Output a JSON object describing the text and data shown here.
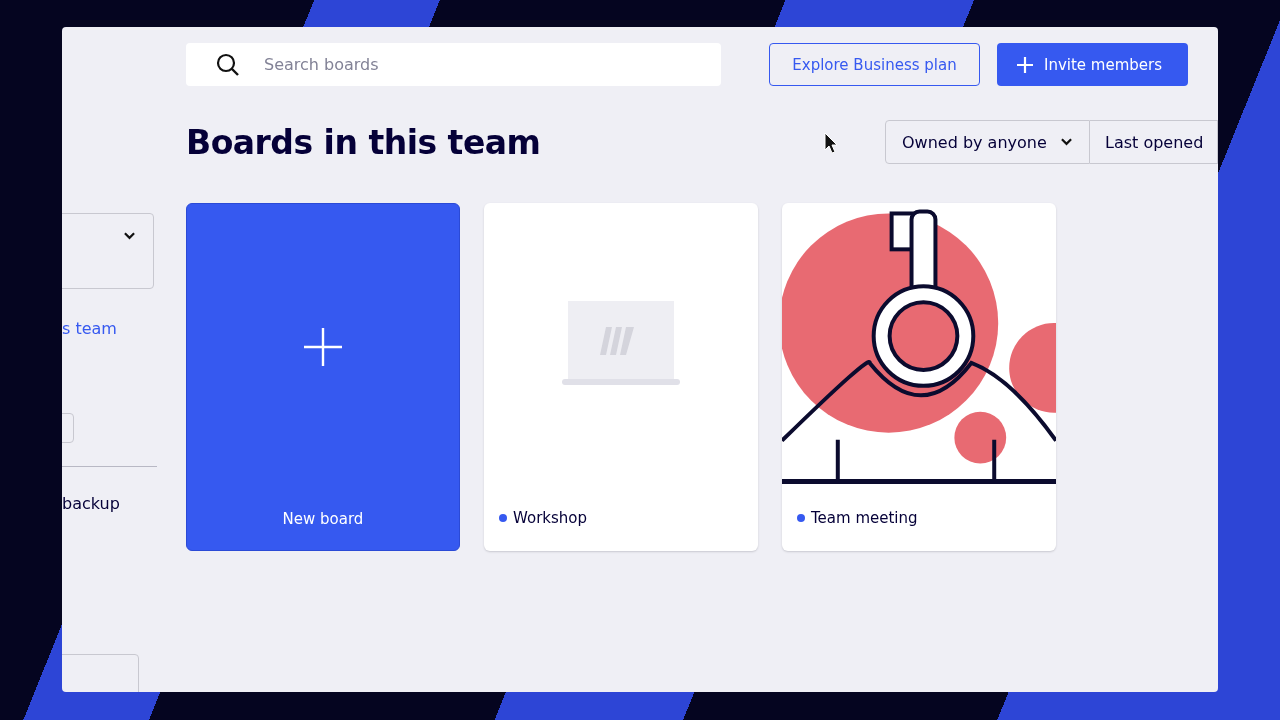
{
  "sidebar": {
    "link": "s team",
    "item": "backup"
  },
  "search": {
    "placeholder": "Search boards"
  },
  "header_buttons": [
    {
      "label": "Explore Business plan",
      "kind": "outline"
    },
    {
      "label": "Invite members",
      "kind": "primary"
    }
  ],
  "title": "Boards in this team",
  "sort": [
    {
      "label": "Owned by anyone",
      "kind": "dropdown"
    },
    {
      "label": "Last opened",
      "kind": "plain"
    }
  ],
  "new_board": {
    "label": "New board"
  },
  "boards": [
    {
      "name": "Workshop",
      "kind": "placeholder"
    },
    {
      "name": "Team meeting",
      "kind": "illustration"
    }
  ]
}
